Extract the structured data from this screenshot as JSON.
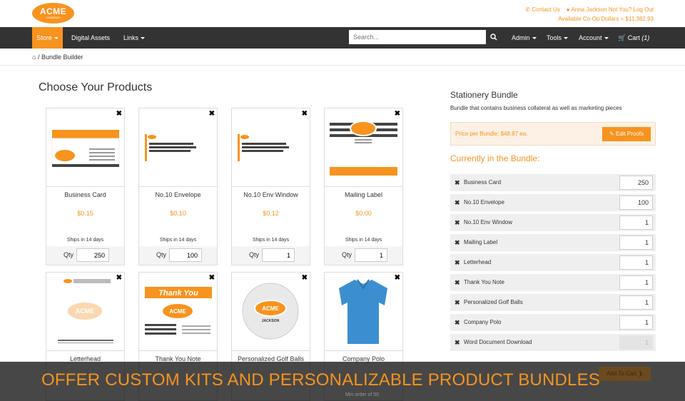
{
  "header": {
    "logo_top": "ACME",
    "logo_bottom": "COMPANY",
    "contact_us": "Contact Us",
    "user_text": "Anna Jackson Not You? Log Out",
    "coop_text": "Available Co-Op Dollars = $11,382.93"
  },
  "nav": {
    "store": "Store",
    "digital_assets": "Digital Assets",
    "links": "Links",
    "search_placeholder": "Search...",
    "admin": "Admin",
    "tools": "Tools",
    "account": "Account",
    "cart": "Cart",
    "cart_count": "(1)"
  },
  "breadcrumb": {
    "current": "Bundle Builder"
  },
  "page_title": "Choose Your Products",
  "qty_label": "Qty",
  "products": [
    {
      "name": "Business Card",
      "price": "$0.15",
      "ship": "Ships in 14 days",
      "qty": "250"
    },
    {
      "name": "No.10 Envelope",
      "price": "$0.10",
      "ship": "Ships in 14 days",
      "qty": "100"
    },
    {
      "name": "No.10 Env Window",
      "price": "$0.12",
      "ship": "Ships in 14 days",
      "qty": "1"
    },
    {
      "name": "Mailing Label",
      "price": "$0.00",
      "ship": "Ships in 14 days",
      "qty": "1"
    },
    {
      "name": "Letterhead"
    },
    {
      "name": "Thank You Note"
    },
    {
      "name": "Personalized Golf Balls"
    },
    {
      "name": "Company Polo"
    }
  ],
  "thank_you_text": "Thank You",
  "golf_text": "JACKSON",
  "bundle": {
    "title": "Stationery Bundle",
    "description": "Bundle that contains business collateral as well as marketing pieces",
    "price_label": "Price per Bundle: $48.87 ea.",
    "edit_proofs": "Edit Proofs",
    "currently_label": "Currently in the Bundle:",
    "items": [
      {
        "name": "Business Card",
        "qty": "250"
      },
      {
        "name": "No.10 Envelope",
        "qty": "100"
      },
      {
        "name": "No.10 Env Window",
        "qty": "1"
      },
      {
        "name": "Mailing Label",
        "qty": "1"
      },
      {
        "name": "Letterhead",
        "qty": "1"
      },
      {
        "name": "Thank You Note",
        "qty": "1"
      },
      {
        "name": "Personalized Golf Balls",
        "qty": "1"
      },
      {
        "name": "Company Polo",
        "qty": "1"
      },
      {
        "name": "Word Document Download",
        "qty": "1"
      }
    ],
    "add_to_cart": "Add To Cart"
  },
  "min_order": "Min order of 50",
  "banner_text": "OFFER CUSTOM KITS AND PERSONALIZABLE PRODUCT BUNDLES",
  "colors": {
    "accent": "#f7931e",
    "nav": "#333333"
  }
}
